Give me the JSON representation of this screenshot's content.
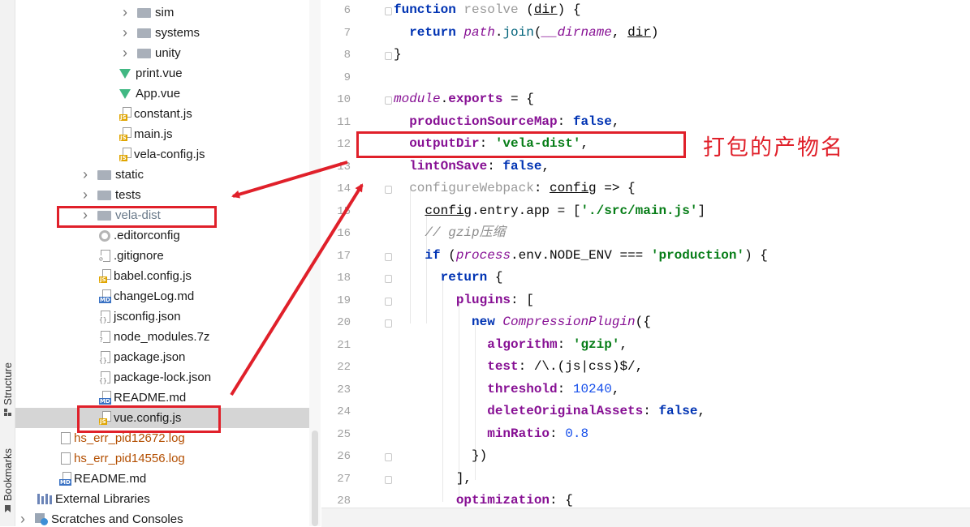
{
  "side_tabs": {
    "structure": "Structure",
    "bookmarks": "Bookmarks"
  },
  "tree": {
    "items": [
      {
        "name": "sim",
        "type": "folder",
        "chevron": true
      },
      {
        "name": "systems",
        "type": "folder",
        "chevron": true
      },
      {
        "name": "unity",
        "type": "folder",
        "chevron": true
      },
      {
        "name": "print.vue",
        "type": "vue"
      },
      {
        "name": "App.vue",
        "type": "vue"
      },
      {
        "name": "constant.js",
        "type": "js"
      },
      {
        "name": "main.js",
        "type": "js"
      },
      {
        "name": "vela-config.js",
        "type": "js"
      },
      {
        "name": "static",
        "type": "folder",
        "chevron": true
      },
      {
        "name": "tests",
        "type": "folder",
        "chevron": true
      },
      {
        "name": "vela-dist",
        "type": "folder",
        "chevron": true,
        "style": "orange"
      },
      {
        "name": ".editorconfig",
        "type": "gear"
      },
      {
        "name": ".gitignore",
        "type": "file"
      },
      {
        "name": "babel.config.js",
        "type": "js"
      },
      {
        "name": "changeLog.md",
        "type": "md"
      },
      {
        "name": "jsconfig.json",
        "type": "json"
      },
      {
        "name": "node_modules.7z",
        "type": "unknown"
      },
      {
        "name": "package.json",
        "type": "json"
      },
      {
        "name": "package-lock.json",
        "type": "json"
      },
      {
        "name": "README.md",
        "type": "md"
      },
      {
        "name": "vue.config.js",
        "type": "js",
        "selected": true
      },
      {
        "name": "hs_err_pid12672.log",
        "type": "log",
        "style": "orange"
      },
      {
        "name": "hs_err_pid14556.log",
        "type": "log",
        "style": "orange"
      },
      {
        "name": "README.md",
        "type": "md"
      },
      {
        "name": "External Libraries",
        "type": "lib"
      },
      {
        "name": "Scratches and Consoles",
        "type": "scratch",
        "chevron": true
      }
    ]
  },
  "editor": {
    "line_numbers": [
      "6",
      "7",
      "8",
      "9",
      "10",
      "11",
      "12",
      "13",
      "14",
      "15",
      "16",
      "17",
      "18",
      "19",
      "20",
      "21",
      "22",
      "23",
      "24",
      "25",
      "26",
      "27",
      "28"
    ],
    "lines": [
      [
        [
          "kw",
          "function "
        ],
        [
          "gray",
          "resolve "
        ],
        [
          "",
          "("
        ],
        [
          "u",
          "dir"
        ],
        [
          "",
          ") {"
        ]
      ],
      [
        [
          "",
          "  "
        ],
        [
          "kw",
          "return "
        ],
        [
          "it",
          "path"
        ],
        [
          "",
          "."
        ],
        [
          "fn",
          "join"
        ],
        [
          "",
          "("
        ],
        [
          "it",
          "__dirname"
        ],
        [
          "",
          ", "
        ],
        [
          "u",
          "dir"
        ],
        [
          "",
          ")"
        ]
      ],
      [
        [
          "",
          "}"
        ]
      ],
      [],
      [
        [
          "it",
          "module"
        ],
        [
          "",
          "."
        ],
        [
          "prop",
          "exports"
        ],
        [
          "",
          " = {"
        ]
      ],
      [
        [
          "",
          "  "
        ],
        [
          "prop",
          "productionSourceMap"
        ],
        [
          "",
          ": "
        ],
        [
          "kw",
          "false"
        ],
        [
          "",
          ","
        ]
      ],
      [
        [
          "",
          "  "
        ],
        [
          "prop",
          "outputDir"
        ],
        [
          "",
          ": "
        ],
        [
          "str",
          "'vela-dist'"
        ],
        [
          "",
          ","
        ]
      ],
      [
        [
          "",
          "  "
        ],
        [
          "prop",
          "lintOnSave"
        ],
        [
          "",
          ": "
        ],
        [
          "kw",
          "false"
        ],
        [
          "",
          ","
        ]
      ],
      [
        [
          "",
          "  "
        ],
        [
          "gray",
          "configureWebpack"
        ],
        [
          "",
          ": "
        ],
        [
          "u",
          "config"
        ],
        [
          "",
          " => {"
        ]
      ],
      [
        [
          "",
          "    "
        ],
        [
          "u",
          "config"
        ],
        [
          "",
          ".entry.app = ["
        ],
        [
          "str",
          "'./src/main.js'"
        ],
        [
          "",
          "]"
        ]
      ],
      [
        [
          "",
          "    "
        ],
        [
          "cmt",
          "// gzip压缩"
        ]
      ],
      [
        [
          "",
          "    "
        ],
        [
          "kw",
          "if "
        ],
        [
          "",
          "("
        ],
        [
          "it",
          "process"
        ],
        [
          "",
          ".env.NODE_ENV === "
        ],
        [
          "str",
          "'production'"
        ],
        [
          "",
          ") {"
        ]
      ],
      [
        [
          "",
          "      "
        ],
        [
          "kw",
          "return "
        ],
        [
          "",
          "{"
        ]
      ],
      [
        [
          "",
          "        "
        ],
        [
          "prop",
          "plugins"
        ],
        [
          "",
          ": ["
        ]
      ],
      [
        [
          "",
          "          "
        ],
        [
          "kw",
          "new "
        ],
        [
          "it",
          "CompressionPlugin"
        ],
        [
          "",
          "({"
        ]
      ],
      [
        [
          "",
          "            "
        ],
        [
          "prop",
          "algorithm"
        ],
        [
          "",
          ": "
        ],
        [
          "str",
          "'gzip'"
        ],
        [
          "",
          ","
        ]
      ],
      [
        [
          "",
          "            "
        ],
        [
          "prop",
          "test"
        ],
        [
          "",
          ": /\\.(js|css)$/,"
        ]
      ],
      [
        [
          "",
          "            "
        ],
        [
          "prop",
          "threshold"
        ],
        [
          "",
          ": "
        ],
        [
          "num",
          "10240"
        ],
        [
          "",
          ","
        ]
      ],
      [
        [
          "",
          "            "
        ],
        [
          "prop",
          "deleteOriginalAssets"
        ],
        [
          "",
          ": "
        ],
        [
          "kw",
          "false"
        ],
        [
          "",
          ","
        ]
      ],
      [
        [
          "",
          "            "
        ],
        [
          "prop",
          "minRatio"
        ],
        [
          "",
          ": "
        ],
        [
          "num",
          "0.8"
        ]
      ],
      [
        [
          "",
          "          "
        ],
        [
          "",
          "})"
        ]
      ],
      [
        [
          "",
          "        "
        ],
        [
          "",
          "],"
        ]
      ],
      [
        [
          "",
          "        "
        ],
        [
          "prop",
          "optimization"
        ],
        [
          "",
          ": {"
        ]
      ]
    ]
  },
  "annotation": {
    "note": "打包的产物名",
    "color": "#e0202a"
  }
}
